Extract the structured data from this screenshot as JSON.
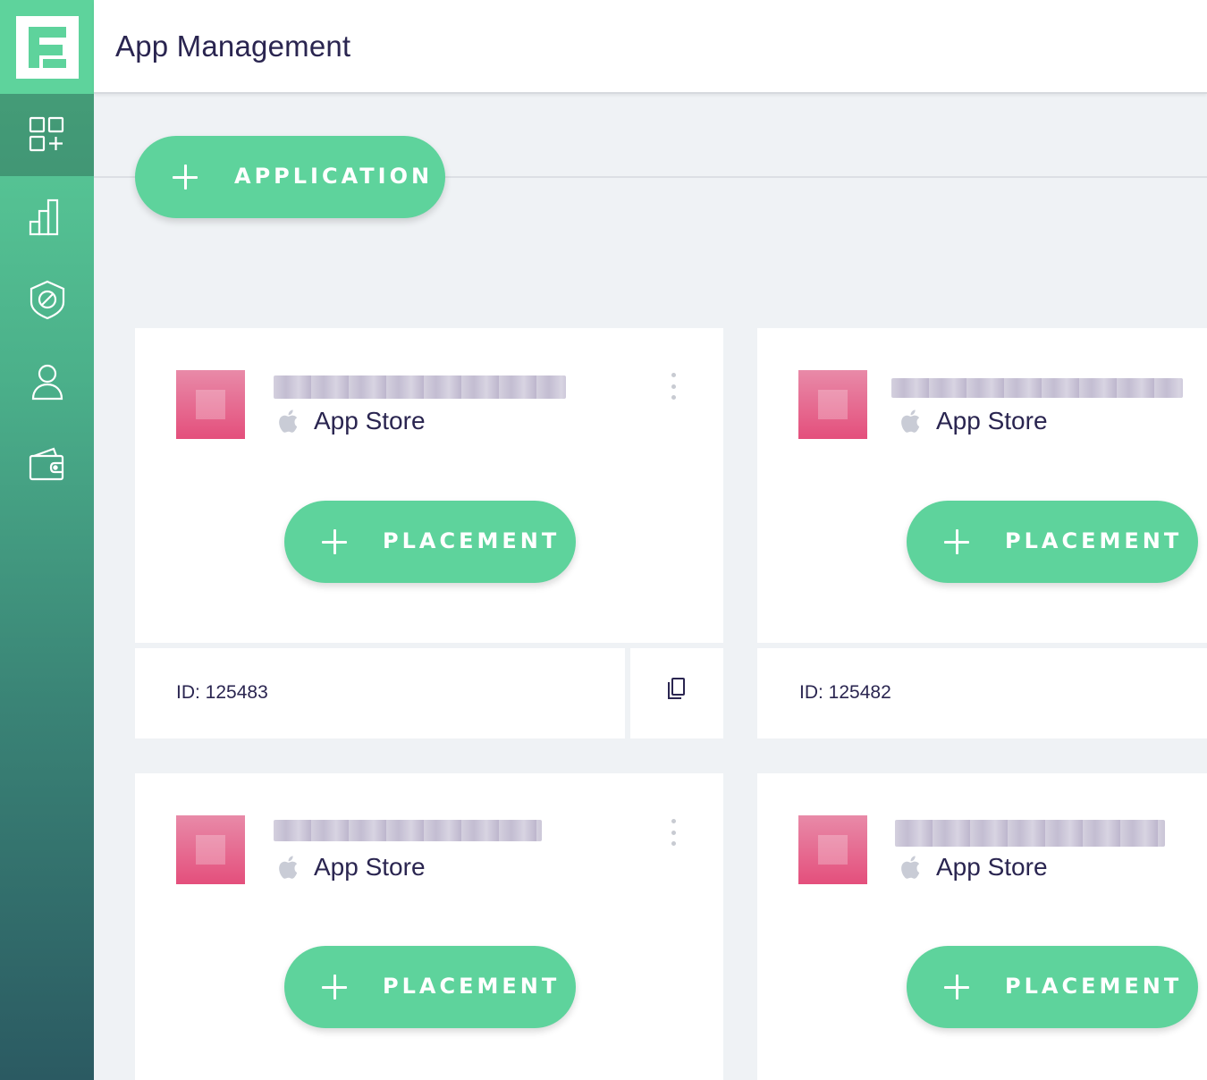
{
  "header": {
    "title": "App Management"
  },
  "sidebar": {
    "items": [
      {
        "name": "apps",
        "icon": "apps-add-icon",
        "active": true
      },
      {
        "name": "analytics",
        "icon": "bar-chart-icon",
        "active": false
      },
      {
        "name": "blocking",
        "icon": "shield-block-icon",
        "active": false
      },
      {
        "name": "account",
        "icon": "user-icon",
        "active": false
      },
      {
        "name": "payments",
        "icon": "wallet-icon",
        "active": false
      }
    ]
  },
  "toolbar": {
    "add_application_label": "APPLICATION"
  },
  "apps": [
    {
      "store": "App Store",
      "placement_label": "PLACEMENT",
      "id_text": "ID: 125483"
    },
    {
      "store": "App Store",
      "placement_label": "PLACEMENT",
      "id_text": "ID: 125482"
    },
    {
      "store": "App Store",
      "placement_label": "PLACEMENT"
    },
    {
      "store": "App Store",
      "placement_label": "PLACEMENT"
    }
  ],
  "colors": {
    "accent": "#5ed39c",
    "sidebar_bottom": "#2b5a62",
    "thumb_top": "#e88aa8",
    "thumb_bottom": "#e44f7c",
    "text": "#2a2550",
    "background": "#eff2f5"
  }
}
